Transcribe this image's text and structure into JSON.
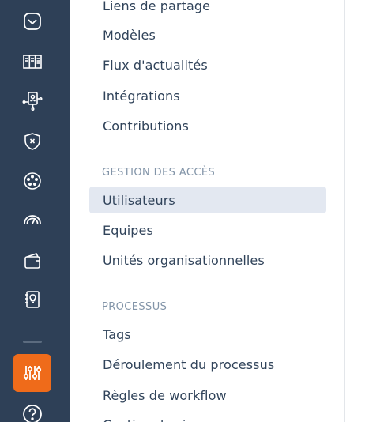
{
  "rail": {
    "icons": [
      "checkmark-badge-icon",
      "kanban-board-icon",
      "network-person-icon",
      "shield-x-icon",
      "palette-icon",
      "speedometer-icon",
      "wallet-icon",
      "lightbulb-book-icon",
      "settings-sliders-icon",
      "help-icon"
    ],
    "active_color": "#ef6b1a",
    "background": "#2e4057"
  },
  "menu": {
    "group1": {
      "items": [
        "Liens de partage",
        "Modèles",
        "Flux d'actualités",
        "Intégrations",
        "Contributions"
      ]
    },
    "group2": {
      "title": "GESTION DES ACCÈS",
      "items": [
        "Utilisateurs",
        "Equipes",
        "Unités organisationnelles"
      ],
      "selected": "Utilisateurs"
    },
    "group3": {
      "title": "PROCESSUS",
      "items": [
        "Tags",
        "Déroulement du processus",
        "Règles de workflow",
        "Gestion des i"
      ]
    }
  }
}
